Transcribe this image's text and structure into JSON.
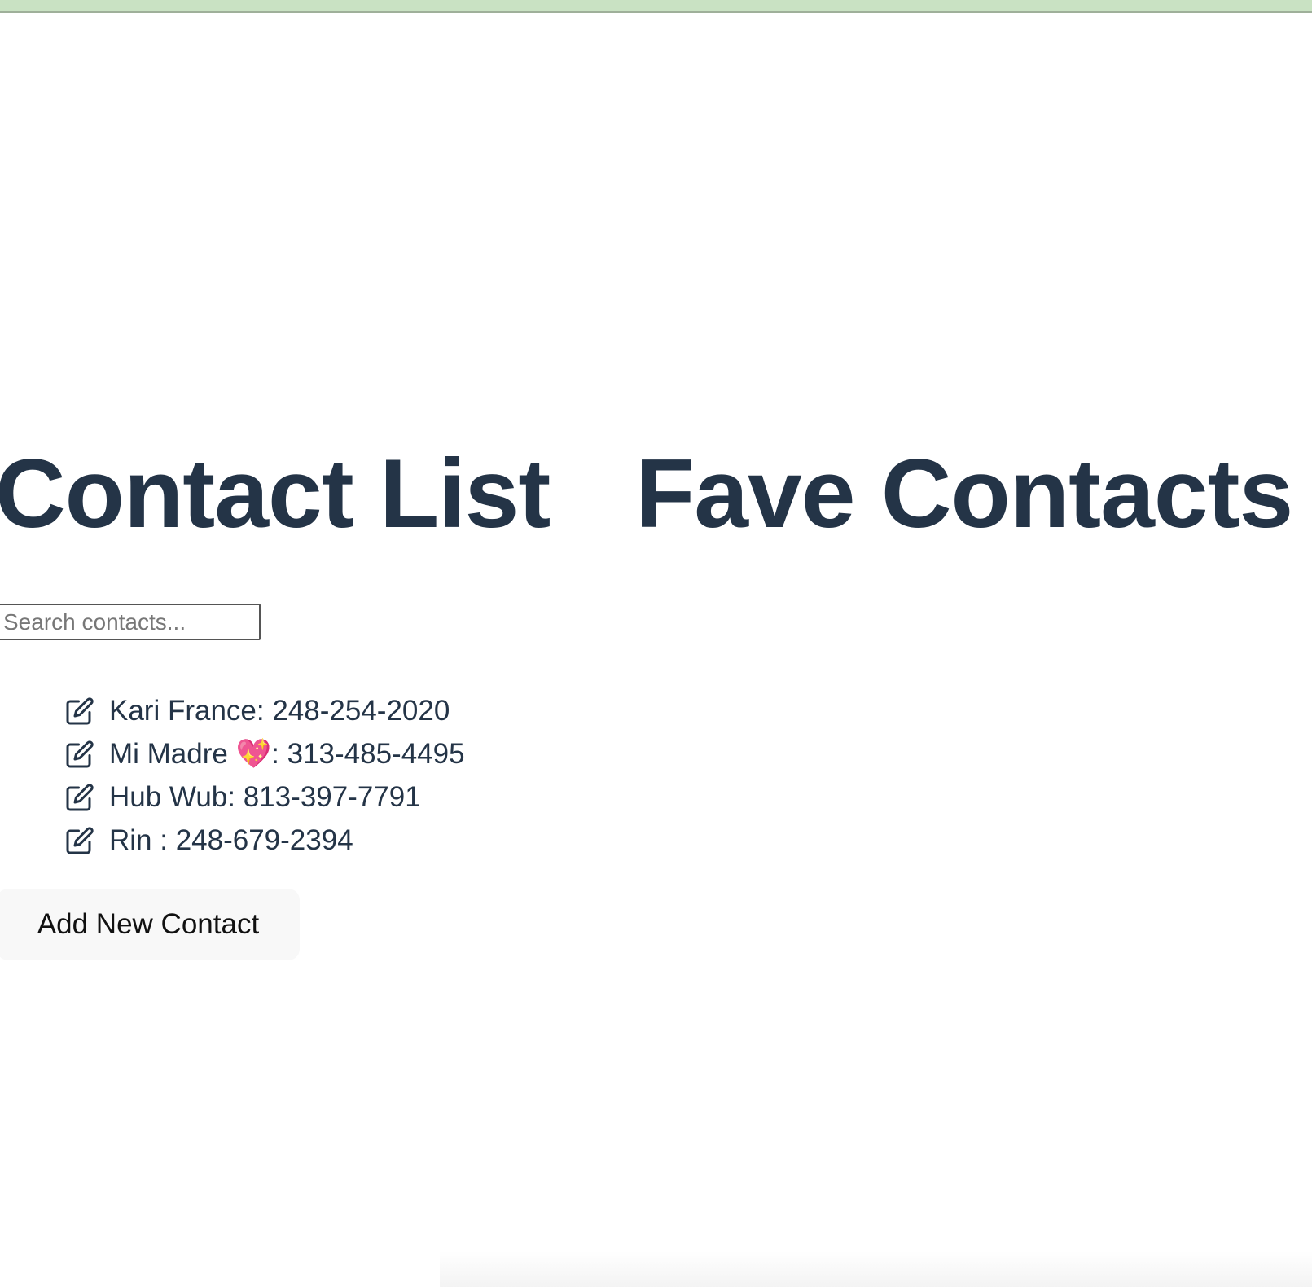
{
  "colors": {
    "top_bar": "#c9e2c3",
    "heading": "#243447",
    "text": "#243447",
    "button_bg": "#f8f8f8"
  },
  "headings": {
    "contact_list": "Contact List",
    "fave_contacts": "Fave Contacts"
  },
  "search": {
    "placeholder": "Search contacts...",
    "value": ""
  },
  "contacts": [
    {
      "label": "Kari France: 248-254-2020",
      "icon": "edit-icon"
    },
    {
      "label": "Mi Madre 💖: 313-485-4495",
      "icon": "edit-icon"
    },
    {
      "label": "Hub Wub: 813-397-7791",
      "icon": "edit-icon"
    },
    {
      "label": "Rin : 248-679-2394",
      "icon": "edit-icon"
    }
  ],
  "actions": {
    "add_contact_label": "Add New Contact"
  }
}
